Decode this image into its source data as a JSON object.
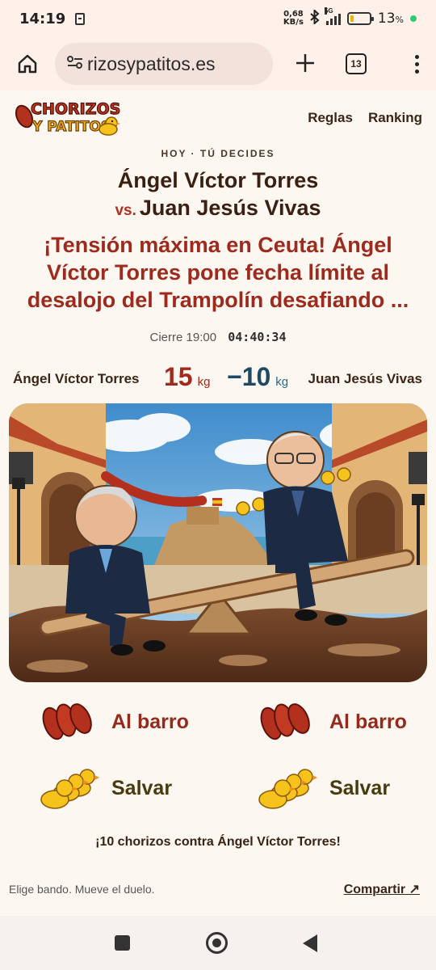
{
  "status_bar": {
    "time": "14:19",
    "net_speed_top": "0,68",
    "net_speed_bottom": "KB/s",
    "network": "5G",
    "battery_pct": "13",
    "battery_unit": "%"
  },
  "browser": {
    "url": "rizosypatitos.es",
    "tab_count": "13"
  },
  "site": {
    "logo_line1": "CHORIZOS",
    "logo_line2": "Y PATITOS",
    "nav": [
      "Reglas",
      "Ranking"
    ]
  },
  "duel": {
    "kicker": "HOY · TÚ DECIDES",
    "player_a": "Ángel Víctor Torres",
    "vs": "vs.",
    "player_b": "Juan Jesús Vivas",
    "headline": "¡Tensión máxima en Ceuta! Ángel Víctor Torres pone fecha límite al desalojo del Trampolín desafiando ...",
    "close_label": "Cierre 19:00",
    "countdown": "04:40:34",
    "score_a": "15",
    "score_b": "−10",
    "unit": "kg"
  },
  "actions": {
    "mud_label": "Al barro",
    "save_label": "Salvar"
  },
  "message": "¡10 chorizos contra Ángel Víctor Torres!",
  "footer": {
    "hint": "Elige bando. Mueve el duelo.",
    "share": "Compartir ↗"
  },
  "colors": {
    "background": "#fcf8f1",
    "accent_red": "#9d2a1c",
    "accent_blue": "#1e4a63"
  },
  "icons": [
    "home-icon",
    "site-settings-icon",
    "plus-icon",
    "tabs-icon",
    "more-vert-icon",
    "sausage-icon",
    "duck-icon",
    "bluetooth-icon",
    "battery-icon"
  ]
}
